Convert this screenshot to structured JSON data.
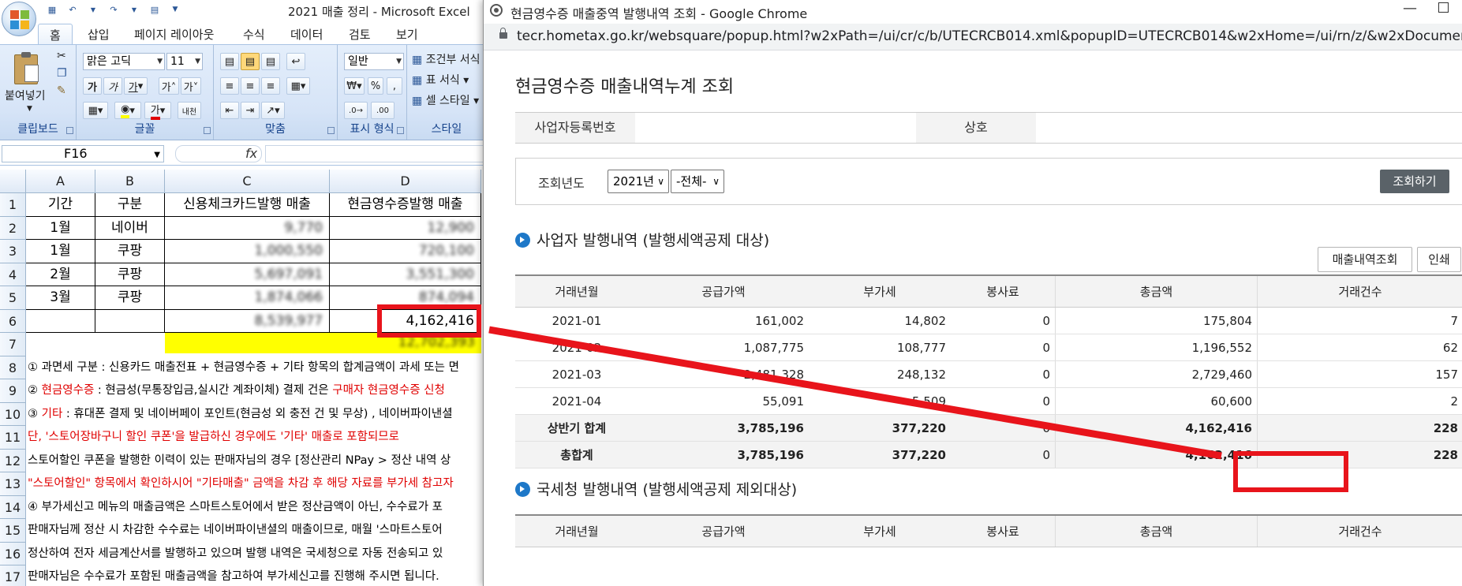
{
  "excel": {
    "window_title": "2021 매출 정리 - Microsoft Excel",
    "tabs": [
      "홈",
      "삽입",
      "페이지 레이아웃",
      "수식",
      "데이터",
      "검토",
      "보기"
    ],
    "ribbon": {
      "paste_label": "붙여넣기",
      "font_name": "맑은 고딕",
      "font_size": "11",
      "number_format": "일반",
      "conditional_format": "조건부 서식",
      "table_format": "표 서식",
      "cell_style": "셀 스타일",
      "groups": [
        "클립보드",
        "글꼴",
        "맞춤",
        "표시 형식",
        "스타일"
      ]
    },
    "name_box": "F16",
    "fx_label": "fx",
    "columns": [
      "A",
      "B",
      "C",
      "D"
    ],
    "rows": [
      "1",
      "2",
      "3",
      "4",
      "5",
      "6",
      "7",
      "8",
      "9",
      "10",
      "11",
      "12",
      "13",
      "14",
      "15",
      "16",
      "17"
    ],
    "table": {
      "headers": [
        "기간",
        "구분",
        "신용체크카드발행 매출",
        "현금영수증발행 매출"
      ],
      "data": [
        [
          "1월",
          "네이버",
          "9,770",
          "12,900"
        ],
        [
          "1월",
          "쿠팡",
          "1,000,550",
          "720,100"
        ],
        [
          "2월",
          "쿠팡",
          "5,697,091",
          "3,551,300"
        ],
        [
          "3월",
          "쿠팡",
          "1,874,066",
          "874,094"
        ]
      ],
      "total_c": "8,539,977",
      "total_d": "4,162,416",
      "grand_total": "12,702,393"
    },
    "notes": [
      {
        "parts": [
          {
            "t": "① 과면세 구분 : 신용카드 매출전표 + 현금영수증 + 기타 항목의 합계금액이 과세 또는 면",
            "red": false
          }
        ]
      },
      {
        "parts": [
          {
            "t": "② ",
            "red": false
          },
          {
            "t": "현금영수증",
            "red": true
          },
          {
            "t": " : 현금성(무통장입금,실시간 계좌이체) 결제 건은 ",
            "red": false
          },
          {
            "t": "구매자 현금영수증 신청",
            "red": true
          }
        ]
      },
      {
        "parts": [
          {
            "t": "③ ",
            "red": false
          },
          {
            "t": "기타",
            "red": true
          },
          {
            "t": " : 휴대폰 결제 및 네이버페이 포인트(현금성 외 충전 건 및 무상) , 네이버파이낸셜",
            "red": false
          }
        ]
      },
      {
        "parts": [
          {
            "t": "단, '스토어장바구니 할인 쿠폰'을 발급하신 경우에도 '기타' 매출로 포함되므로",
            "red": true
          }
        ]
      },
      {
        "parts": [
          {
            "t": "스토어할인 쿠폰을 발행한 이력이 있는 판매자님의 경우 [정산관리 NPay > 정산 내역 상",
            "red": false
          }
        ]
      },
      {
        "parts": [
          {
            "t": "\"스토어할인\" 항목에서 확인하시어 \"기타매출\" 금액을 차감 후 해당 자료를 부가세 참고자",
            "red": true
          }
        ]
      },
      {
        "parts": [
          {
            "t": "④ 부가세신고 메뉴의 매출금액은 스마트스토어에서 받은 정산금액이 아닌, 수수료가 포",
            "red": false
          }
        ]
      },
      {
        "parts": [
          {
            "t": "판매자님께 정산 시 차감한 수수료는 네이버파이낸셜의 매출이므로, 매월 '스마트스토어",
            "red": false
          }
        ]
      },
      {
        "parts": [
          {
            "t": "정산하여 전자 세금계산서를 발행하고 있으며 발행 내역은 국세청으로 자동 전송되고 있",
            "red": false
          }
        ]
      },
      {
        "parts": [
          {
            "t": "판매자님은 수수료가 포함된 매출금액을 참고하여 부가세신고를 진행해 주시면 됩니다.",
            "red": false
          }
        ]
      }
    ]
  },
  "chrome": {
    "window_title": "현금영수증 매출중역 발행내역 조회 - Google Chrome",
    "url": "tecr.hometax.go.kr/websquare/popup.html?w2xPath=/ui/cr/c/b/UTECRCB014.xml&popupID=UTECRCB014&w2xHome=/ui/rn/z/&w2xDocumentRoot=",
    "page_title": "현금영수증 매출내역누계 조회",
    "lookup": {
      "reg_no_label": "사업자등록번호",
      "name_label": "상호"
    },
    "search": {
      "label": "조회년도",
      "year": "2021년",
      "period": "-전체-",
      "button": "조회하기"
    },
    "section1": {
      "title": "사업자 발행내역 (발행세액공제 대상)",
      "btn_sales": "매출내역조회",
      "btn_print": "인쇄",
      "headers": [
        "거래년월",
        "공급가액",
        "부가세",
        "봉사료",
        "총금액",
        "거래건수"
      ],
      "rows": [
        [
          "2021-01",
          "161,002",
          "14,802",
          "0",
          "175,804",
          "7"
        ],
        [
          "2021-02",
          "1,087,775",
          "108,777",
          "0",
          "1,196,552",
          "62"
        ],
        [
          "2021-03",
          "2,481,328",
          "248,132",
          "0",
          "2,729,460",
          "157"
        ],
        [
          "2021-04",
          "55,091",
          "5,509",
          "0",
          "60,600",
          "2"
        ]
      ],
      "half_total": [
        "상반기 합계",
        "3,785,196",
        "377,220",
        "0",
        "4,162,416",
        "228"
      ],
      "grand_total": [
        "총합계",
        "3,785,196",
        "377,220",
        "0",
        "4,162,416",
        "228"
      ]
    },
    "section2": {
      "title": "국세청 발행내역 (발행세액공제 제외대상)",
      "headers": [
        "거래년월",
        "공급가액",
        "부가세",
        "봉사료",
        "총금액",
        "거래건수"
      ]
    }
  },
  "annotation": {
    "color": "#e8141b"
  }
}
